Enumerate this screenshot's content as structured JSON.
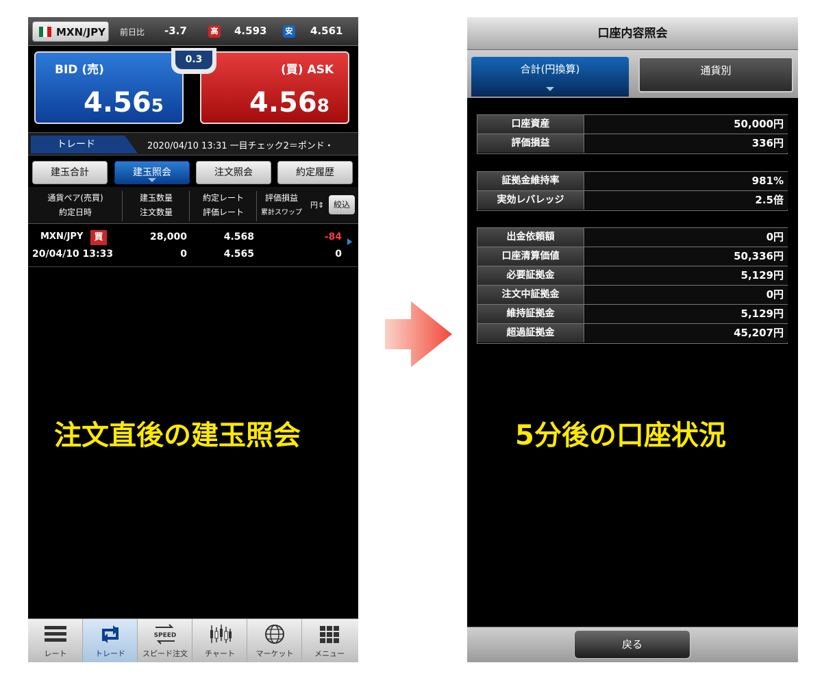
{
  "left": {
    "pair": "MXN/JPY",
    "change_label": "前日比",
    "change_value": "-3.7",
    "high_badge": "高",
    "high_value": "4.593",
    "low_badge": "安",
    "low_value": "4.561",
    "bid_label": "BID (売)",
    "bid_main": "4.56",
    "bid_last": "5",
    "ask_label": "(買) ASK",
    "ask_main": "4.56",
    "ask_last": "8",
    "spread": "0.3",
    "trade_tab": "トレード",
    "ticker": "2020/04/10 13:31 一目チェック2＝ポンド・",
    "tabs": [
      "建玉合計",
      "建玉照会",
      "注文照会",
      "約定履歴"
    ],
    "headers": {
      "c1a": "通貨ペア(売買)",
      "c1b": "約定日時",
      "c2a": "建玉数量",
      "c2b": "注文数量",
      "c3a": "約定レート",
      "c3b": "評価レート",
      "c4a": "評価損益",
      "c4b": "累計スワップ",
      "unit": "円",
      "sort": "絞込"
    },
    "position": {
      "pair": "MXN/JPY",
      "side": "買",
      "date": "20/04/10 13:33",
      "qty": "28,000",
      "order_qty": "0",
      "rate": "4.568",
      "eval_rate": "4.565",
      "pl": "-84",
      "swap": "0"
    },
    "overlay": "注文直後の建玉照会",
    "bottom_tabs": [
      "レート",
      "トレード",
      "スピード注文",
      "チャート",
      "マーケット",
      "メニュー"
    ],
    "speed_icon_text": "SPEED"
  },
  "right": {
    "title": "口座内容照会",
    "tab_active": "合計(円換算)",
    "tab_other": "通貨別",
    "block1": [
      {
        "k": "口座資産",
        "v": "50,000円"
      },
      {
        "k": "評価損益",
        "v": "336円"
      }
    ],
    "block2": [
      {
        "k": "証拠金維持率",
        "v": "981%"
      },
      {
        "k": "実効レバレッジ",
        "v": "2.5倍"
      }
    ],
    "block3": [
      {
        "k": "出金依頼額",
        "v": "0円"
      },
      {
        "k": "口座清算価値",
        "v": "50,336円"
      },
      {
        "k": "必要証拠金",
        "v": "5,129円"
      },
      {
        "k": "注文中証拠金",
        "v": "0円"
      },
      {
        "k": "維持証拠金",
        "v": "5,129円"
      },
      {
        "k": "超過証拠金",
        "v": "45,207円"
      }
    ],
    "overlay": "5分後の口座状況",
    "back": "戻る"
  },
  "colors": {
    "bid": "#0c3f9a",
    "ask": "#a60c0c",
    "overlay": "#ffea00",
    "negative": "#ff3b3b",
    "arrow": "#f05a4a"
  }
}
